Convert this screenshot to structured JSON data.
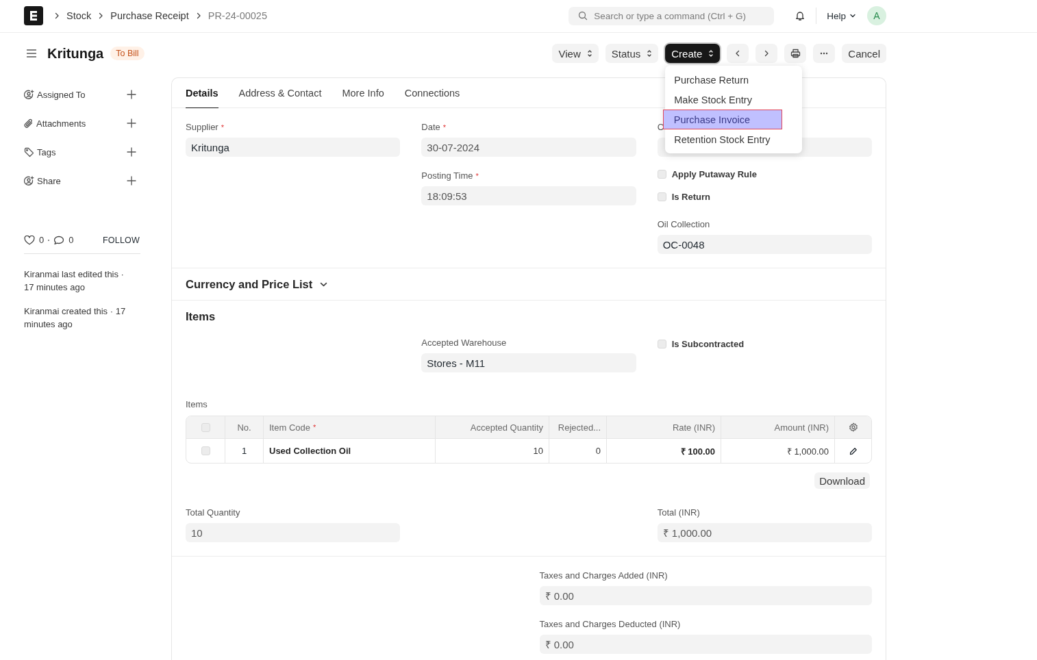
{
  "navbar": {
    "breadcrumbs": [
      {
        "label": "Stock",
        "current": false
      },
      {
        "label": "Purchase Receipt",
        "current": false
      },
      {
        "label": "PR-24-00025",
        "current": true
      }
    ],
    "search": {
      "placeholder": "Search or type a command (Ctrl + G)"
    },
    "help": "Help",
    "avatar": "A"
  },
  "header": {
    "title": "Kritunga",
    "status": "To Bill",
    "buttons": [
      {
        "kind": "dropdown",
        "label": "View"
      },
      {
        "kind": "dropdown",
        "label": "Status"
      },
      {
        "kind": "primary",
        "label": "Create",
        "open": true,
        "menu": [
          {
            "label": "Purchase Return",
            "selected": false
          },
          {
            "label": "Make Stock Entry",
            "selected": false
          },
          {
            "label": "Purchase Invoice",
            "selected": true
          },
          {
            "label": "Retention Stock Entry",
            "selected": false
          }
        ]
      },
      {
        "kind": "prev"
      },
      {
        "kind": "next"
      },
      {
        "kind": "print"
      },
      {
        "kind": "more"
      },
      {
        "kind": "plain",
        "label": "Cancel"
      }
    ]
  },
  "sidebar": {
    "actions": [
      {
        "kind": "assign",
        "label": "Assigned To"
      },
      {
        "kind": "attach",
        "label": "Attachments"
      },
      {
        "kind": "tag",
        "label": "Tags"
      },
      {
        "kind": "share",
        "label": "Share"
      }
    ],
    "likes": "0",
    "comments": "0",
    "follow": "FOLLOW",
    "activity": [
      "Kiranmai last edited this · 17 minutes ago",
      "Kiranmai created this · 17 minutes ago"
    ]
  },
  "form": {
    "tabs": [
      {
        "label": "Details",
        "selected": true
      },
      {
        "label": "Address & Contact",
        "selected": false
      },
      {
        "label": "More Info",
        "selected": false
      },
      {
        "label": "Connections",
        "selected": false
      }
    ],
    "sections": [
      {
        "blocks": [
          {
            "kind": "columns",
            "columns": [
              [
                {
                  "kind": "input",
                  "label": "Supplier",
                  "mark": "*",
                  "value": "Kritunga",
                  "read_only": false
                }
              ],
              [
                {
                  "kind": "input",
                  "label": "Date",
                  "mark": "*",
                  "value": "30-07-2024",
                  "read_only": true
                },
                {
                  "kind": "input",
                  "label": "Posting Time",
                  "mark": "*",
                  "value": "18:09:53",
                  "read_only": true
                }
              ],
              [
                {
                  "kind": "input",
                  "label": "C"
                },
                {
                  "kind": "check",
                  "label": "Apply Putaway Rule",
                  "checked": false
                },
                {
                  "kind": "check",
                  "label": "Is Return",
                  "checked": false
                },
                {
                  "kind": "input",
                  "label": "Oil Collection",
                  "value": "OC-0048",
                  "read_only": false
                }
              ]
            ]
          }
        ]
      },
      {
        "title": "Currency and Price List",
        "expanded": false
      },
      {
        "title": "Items",
        "blocks": [
          {
            "kind": "columns",
            "columns": [
              [],
              [
                {
                  "kind": "input",
                  "label": "Accepted Warehouse",
                  "value": "Stores - M11",
                  "read_only": false
                }
              ],
              [
                {
                  "kind": "check",
                  "label": "Is Subcontracted",
                  "checked": false
                }
              ]
            ]
          },
          {
            "kind": "table",
            "label": "Items",
            "header_checked": false,
            "columns": [
              {
                "label": "No."
              },
              {
                "label": "Item Code",
                "mark": "*"
              },
              {
                "label": "Accepted Quantity"
              },
              {
                "label": "Rejected..."
              },
              {
                "label": "Rate (INR)"
              },
              {
                "label": "Amount (INR)"
              }
            ],
            "rows": [
              {
                "checked": false,
                "cells": [
                  "1",
                  "Used Collection Oil",
                  "10",
                  "0",
                  "₹ 100.00",
                  "₹ 1,000.00"
                ]
              }
            ]
          },
          {
            "kind": "button",
            "label": "Download"
          },
          {
            "kind": "columns",
            "columns": [
              [
                {
                  "kind": "input",
                  "label": "Total Quantity",
                  "value": "10",
                  "read_only": true
                }
              ],
              [],
              [
                {
                  "kind": "input",
                  "label": "Total (INR)",
                  "value": "₹ 1,000.00",
                  "read_only": true
                }
              ]
            ]
          }
        ]
      },
      {
        "blocks": [
          {
            "kind": "columns",
            "columns": [
              [],
              [
                {
                  "kind": "input",
                  "label": "Taxes and Charges Added (INR)",
                  "value": "₹ 0.00",
                  "read_only": true
                },
                {
                  "kind": "input",
                  "label": "Taxes and Charges Deducted (INR)",
                  "value": "₹ 0.00",
                  "read_only": true
                }
              ]
            ]
          }
        ]
      }
    ]
  }
}
